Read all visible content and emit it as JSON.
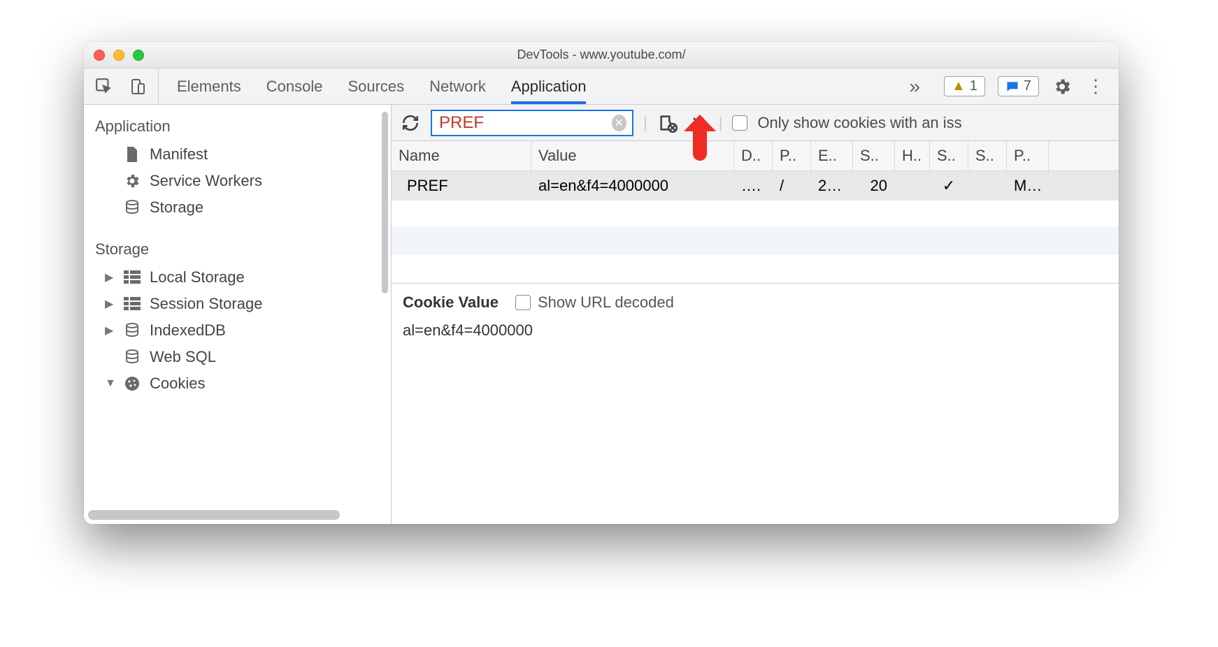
{
  "window": {
    "title": "DevTools - www.youtube.com/"
  },
  "panel_tabs": {
    "items": [
      "Elements",
      "Console",
      "Sources",
      "Network",
      "Application"
    ],
    "active_index": 4,
    "more_glyph": "»"
  },
  "badges": {
    "warnings": "1",
    "messages": "7"
  },
  "sidebar": {
    "sections": {
      "app": {
        "title": "Application",
        "items": [
          {
            "label": "Manifest",
            "icon": "file-icon"
          },
          {
            "label": "Service Workers",
            "icon": "gear-icon"
          },
          {
            "label": "Storage",
            "icon": "database-icon"
          }
        ]
      },
      "storage": {
        "title": "Storage",
        "items": [
          {
            "label": "Local Storage",
            "icon": "grid-icon",
            "expandable": true
          },
          {
            "label": "Session Storage",
            "icon": "grid-icon",
            "expandable": true
          },
          {
            "label": "IndexedDB",
            "icon": "database-icon",
            "expandable": true
          },
          {
            "label": "Web SQL",
            "icon": "database-icon",
            "expandable": false
          },
          {
            "label": "Cookies",
            "icon": "cookie-icon",
            "expandable": true,
            "expanded": true
          }
        ]
      }
    }
  },
  "filter": {
    "value": "PREF",
    "only_issues_label": "Only show cookies with an iss"
  },
  "cookies": {
    "columns": [
      "Name",
      "Value",
      "D..",
      "P..",
      "E..",
      "S..",
      "H..",
      "S..",
      "S..",
      "P.."
    ],
    "rows": [
      {
        "name": "PREF",
        "value": "al=en&f4=4000000",
        "domain": "….",
        "path": "/",
        "expires": "2…",
        "size": "20",
        "httpOnly": "",
        "secure": "✓",
        "sameSite": "",
        "priority": "M…"
      }
    ]
  },
  "cookie_detail": {
    "title": "Cookie Value",
    "decoded_label": "Show URL decoded",
    "value": "al=en&f4=4000000"
  }
}
